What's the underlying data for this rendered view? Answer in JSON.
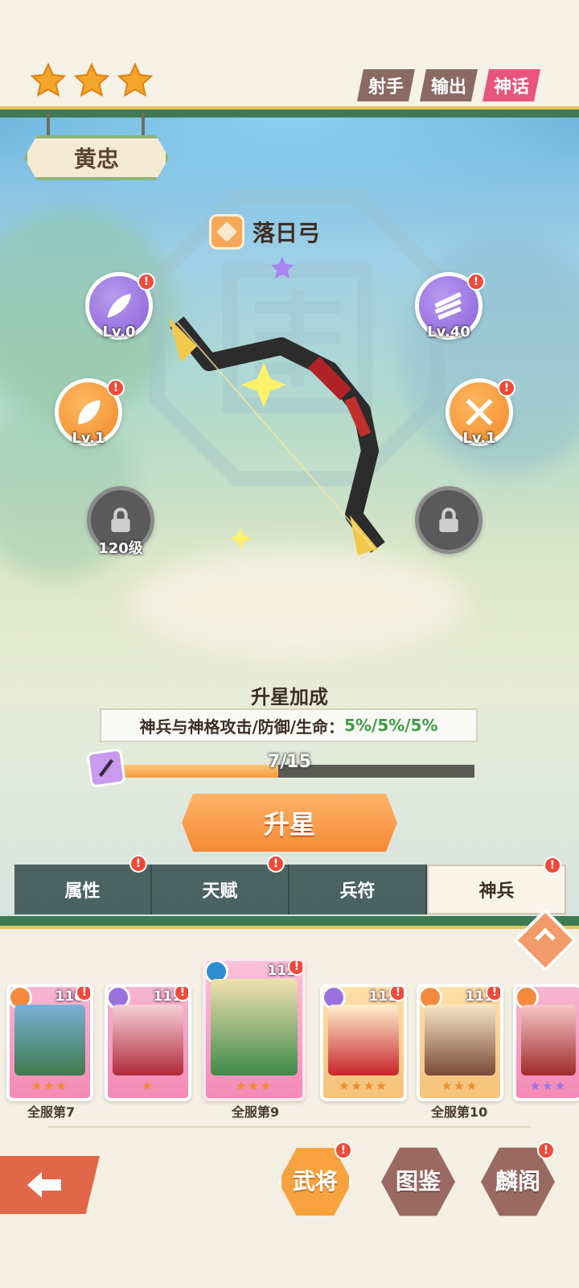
{
  "hero": {
    "name": "黄忠",
    "star_count": 3
  },
  "tags": [
    "射手",
    "输出",
    "神话"
  ],
  "weapon": {
    "name": "落日弓"
  },
  "skills": {
    "left_top": {
      "level": "Lv.0"
    },
    "right_top": {
      "level": "Lv.40"
    },
    "left_mid": {
      "level": "Lv.1"
    },
    "right_mid": {
      "level": "Lv.1"
    },
    "left_lock": {
      "level": "120级"
    }
  },
  "bonus": {
    "title": "升星加成",
    "label": "神兵与神格攻击/防御/生命：",
    "values": "5%/5%/5%"
  },
  "progress": {
    "text": "7/15",
    "current": 7,
    "max": 15
  },
  "upgrade_button": "升星",
  "tabs": [
    "属性",
    "天赋",
    "兵符",
    "神兵"
  ],
  "active_tab": "神兵",
  "badge_mark": "!",
  "roster": [
    {
      "level": "110",
      "stars": "★★★",
      "rank": "全服第7"
    },
    {
      "level": "111",
      "stars": "★"
    },
    {
      "level": "111",
      "stars": "★★★",
      "rank": "全服第9"
    },
    {
      "level": "112",
      "stars": "★★★★"
    },
    {
      "level": "111",
      "stars": "★★★",
      "rank": "全服第10"
    },
    {
      "stars": "★★★"
    }
  ],
  "bottom_nav": {
    "generals": "武将",
    "codex": "图鉴",
    "qilin": "麟阁"
  },
  "colors": {
    "accent": "#f58a36",
    "myth": "#e8557a",
    "green_value": "#3f9a45",
    "trim": "#3f7a52"
  }
}
